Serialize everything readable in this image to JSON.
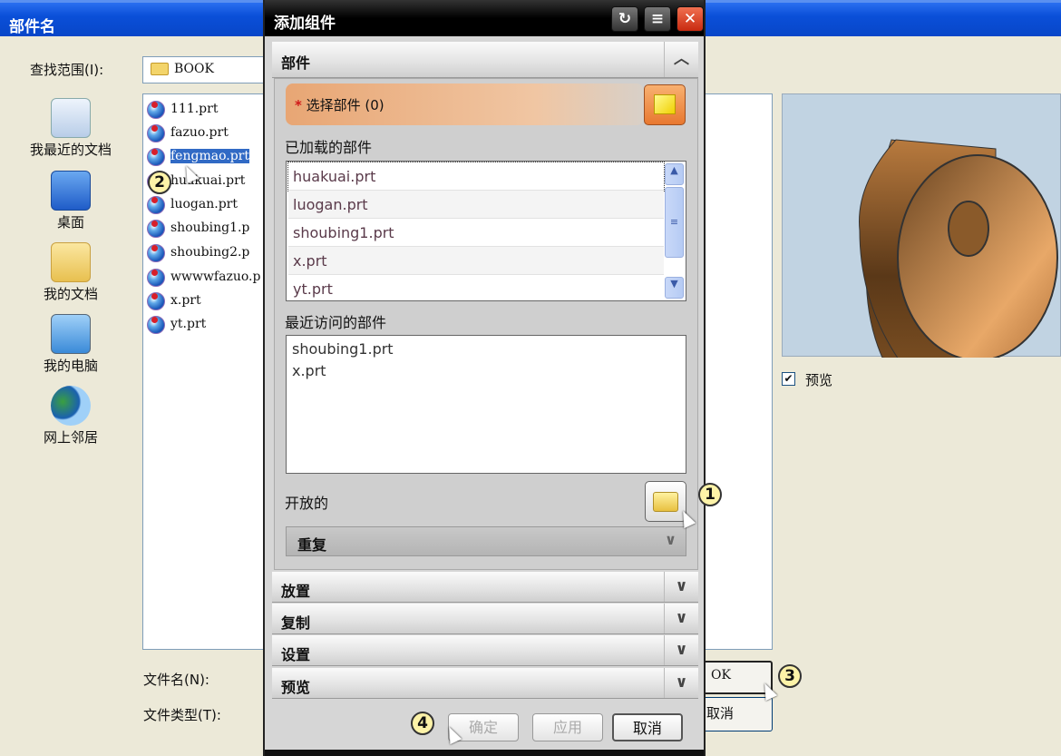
{
  "file_dialog": {
    "title": "部件名",
    "look_in_label": "查找范围(I):",
    "look_in_value": "BOOK",
    "places": [
      "我最近的文档",
      "桌面",
      "我的文档",
      "我的电脑",
      "网上邻居"
    ],
    "files": [
      "111.prt",
      "fazuo.prt",
      "fengmao.prt",
      "huakuai.prt",
      "luogan.prt",
      "shoubing1.p",
      "shoubing2.p",
      "wwwwfazuo.p",
      "x.prt",
      "yt.prt"
    ],
    "selected_file": "fengmao.prt",
    "preview_label": "预览",
    "preview_checked": true,
    "file_name_label": "文件名(N):",
    "file_type_label": "文件类型(T):",
    "ok_label": "OK",
    "cancel_label": "取消"
  },
  "add_component": {
    "title": "添加组件",
    "section_part": "部件",
    "select_part_label": "选择部件 (0)",
    "required_mark": "*",
    "loaded_parts_label": "已加载的部件",
    "loaded_parts": [
      "huakuai.prt",
      "luogan.prt",
      "shoubing1.prt",
      "x.prt",
      "yt.prt"
    ],
    "recent_parts_label": "最近访问的部件",
    "recent_parts": [
      "shoubing1.prt",
      "x.prt"
    ],
    "open_label": "开放的",
    "repeat_label": "重复",
    "sections": [
      "放置",
      "复制",
      "设置",
      "预览"
    ],
    "ok_label": "确定",
    "apply_label": "应用",
    "cancel_label": "取消"
  },
  "callouts": [
    "1",
    "2",
    "3",
    "4"
  ]
}
